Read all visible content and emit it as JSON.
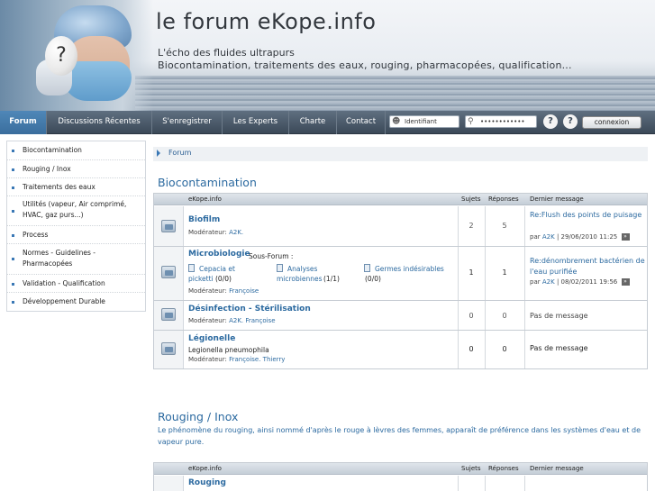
{
  "header": {
    "site_title": "le forum eKope.info",
    "tagline": "L'écho des fluides ultrapurs",
    "subtagline": "Biocontamination, traitements des eaux, rouging, pharmacopées, qualification...",
    "egg_glyph": "?"
  },
  "nav": {
    "items": [
      {
        "label": "Forum",
        "active": true
      },
      {
        "label": "Discussions Récentes"
      },
      {
        "label": "S'enregistrer"
      },
      {
        "label": "Les Experts"
      },
      {
        "label": "Charte"
      },
      {
        "label": "Contact"
      }
    ],
    "login_value": "Identifiant",
    "password_value": "••••••••••••",
    "help_glyph": "?",
    "login_button": "connexion",
    "user_icon": "user-icon",
    "key_icon": "key-icon"
  },
  "sidebar": {
    "items": [
      {
        "label": "Biocontamination"
      },
      {
        "label": "Rouging / Inox"
      },
      {
        "label": "Traitements des eaux"
      },
      {
        "label": "Utilités (vapeur, Air comprimé, HVAC, gaz purs...)"
      },
      {
        "label": "Process"
      },
      {
        "label": "Normes - Guidelines - Pharmacopées"
      },
      {
        "label": "Validation - Qualification"
      },
      {
        "label": "Développement Durable"
      }
    ]
  },
  "breadcrumb": {
    "label": "Forum"
  },
  "sections": [
    {
      "title": "Biocontamination",
      "table_header": {
        "col_forum": "eKope.info",
        "col_subjects": "Sujets",
        "col_replies": "Réponses",
        "col_last": "Dernier message"
      },
      "forums": [
        {
          "name": "Biofilm",
          "moderator_label": "Modérateur:",
          "moderators": "A2K.",
          "subjects": "2",
          "replies": "5",
          "last_title": "Re:Flush des points de puisage",
          "last_by": "par",
          "last_author": "A2K",
          "last_date": "| 29/06/2010 11:25"
        },
        {
          "name": "Microbiologie",
          "subforum_label": "Sous-Forum :",
          "subforums": [
            {
              "label": "Cepacia et",
              "label2": "picketti",
              "count": "(0/0)"
            },
            {
              "label": "Analyses",
              "label2": "microbiennes",
              "count": "(1/1)"
            },
            {
              "label": "Germes indésirables",
              "count": "(0/0)"
            }
          ],
          "moderator_label": "Modérateur:",
          "moderators": "Françoise",
          "subjects": "1",
          "replies": "1",
          "last_title": "Re:dénombrement bactérien de l'eau purifiée",
          "last_by": "par",
          "last_author": "A2K",
          "last_date": "| 08/02/2011 19:56"
        },
        {
          "name": "Désinfection - Stérilisation",
          "moderator_label": "Modérateur:",
          "moderators": "A2K. Françoise",
          "subjects": "0",
          "replies": "0",
          "last_none": "Pas de message"
        },
        {
          "name": "Légionelle",
          "description": "Legionella pneumophila",
          "moderator_label": "Modérateur:",
          "moderators": "Françoise. Thierry",
          "subjects": "0",
          "replies": "0",
          "last_none": "Pas de message"
        }
      ]
    },
    {
      "title": "Rouging / Inox",
      "description": "Le phénomène du rouging, ainsi nommé d'après le rouge à lèvres des femmes, apparaît de préférence dans les systèmes d'eau et de vapeur pure.",
      "table_header": {
        "col_forum": "eKope.info",
        "col_subjects": "Sujets",
        "col_replies": "Réponses",
        "col_last": "Dernier message"
      },
      "forums": [
        {
          "name": "Rouging"
        }
      ]
    }
  ],
  "go_glyph": "»"
}
